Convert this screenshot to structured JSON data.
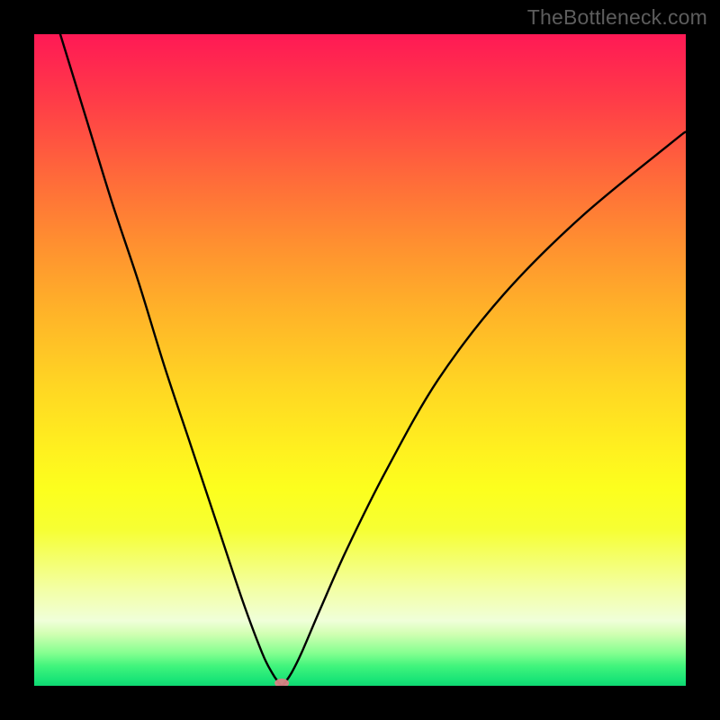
{
  "watermark": "TheBottleneck.com",
  "chart_data": {
    "type": "line",
    "title": "",
    "xlabel": "",
    "ylabel": "",
    "xlim": [
      0,
      100
    ],
    "ylim": [
      0,
      100
    ],
    "grid": false,
    "curve_description": "V-shaped bottleneck curve reaching minimum near x≈38, rising steeply on both sides",
    "minimum_marker": {
      "x": 38,
      "y": 0
    },
    "gradient_colors": {
      "top": "#ff1955",
      "mid": "#ffe021",
      "bottom": "#0fd872"
    },
    "series": [
      {
        "name": "bottleneck-curve",
        "x": [
          4,
          8,
          12,
          16,
          20,
          24,
          28,
          32,
          35,
          36.5,
          37.5,
          38,
          38.5,
          39.5,
          41,
          44,
          48,
          54,
          62,
          72,
          84,
          98,
          100
        ],
        "y": [
          100,
          87,
          74,
          62,
          49,
          37,
          25,
          13,
          5,
          2,
          0.5,
          0,
          0.5,
          2,
          5,
          12,
          21,
          33,
          47,
          60,
          72,
          83.5,
          85
        ]
      }
    ]
  }
}
